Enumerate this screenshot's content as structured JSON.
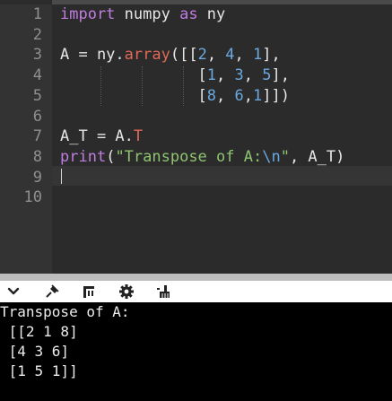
{
  "editor": {
    "lines": [
      {
        "n": "1",
        "tokens": [
          [
            "kw",
            "import"
          ],
          [
            "code",
            " numpy "
          ],
          [
            "kw",
            "as"
          ],
          [
            "code",
            " ny"
          ]
        ]
      },
      {
        "n": "2",
        "tokens": []
      },
      {
        "n": "3",
        "tokens": [
          [
            "code",
            "A = ny."
          ],
          [
            "fn",
            "array"
          ],
          [
            "code",
            "([["
          ],
          [
            "num",
            "2"
          ],
          [
            "code",
            ", "
          ],
          [
            "num",
            "4"
          ],
          [
            "code",
            ", "
          ],
          [
            "num",
            "1"
          ],
          [
            "code",
            "],"
          ]
        ]
      },
      {
        "n": "4",
        "tokens": [
          [
            "code",
            "               ["
          ],
          [
            "num",
            "1"
          ],
          [
            "code",
            ", "
          ],
          [
            "num",
            "3"
          ],
          [
            "code",
            ", "
          ],
          [
            "num",
            "5"
          ],
          [
            "code",
            "],"
          ]
        ]
      },
      {
        "n": "5",
        "tokens": [
          [
            "code",
            "               ["
          ],
          [
            "num",
            "8"
          ],
          [
            "code",
            ", "
          ],
          [
            "num",
            "6"
          ],
          [
            "code",
            ","
          ],
          [
            "num",
            "1"
          ],
          [
            "code",
            "]])"
          ]
        ]
      },
      {
        "n": "6",
        "tokens": []
      },
      {
        "n": "7",
        "tokens": [
          [
            "code",
            "A_T = A."
          ],
          [
            "fn",
            "T"
          ]
        ]
      },
      {
        "n": "8",
        "tokens": [
          [
            "kw",
            "print"
          ],
          [
            "code",
            "("
          ],
          [
            "str",
            "\"Transpose of A:"
          ],
          [
            "esc",
            "\\n"
          ],
          [
            "str",
            "\""
          ],
          [
            "code",
            ", A_T)"
          ]
        ]
      },
      {
        "n": "9",
        "tokens": []
      },
      {
        "n": "10",
        "tokens": []
      }
    ]
  },
  "toolbar": {
    "buttons": [
      {
        "name": "collapse-chevron-icon",
        "glyph": "chevron"
      },
      {
        "name": "pin-icon",
        "glyph": "pin"
      },
      {
        "name": "output-panel-icon",
        "glyph": "panel"
      },
      {
        "name": "gear-icon",
        "glyph": "gear"
      },
      {
        "name": "clear-output-icon",
        "glyph": "clear"
      }
    ]
  },
  "output": {
    "lines": [
      "Transpose of A:",
      " [[2 1 8]",
      " [4 3 6]",
      " [1 5 1]]"
    ]
  }
}
